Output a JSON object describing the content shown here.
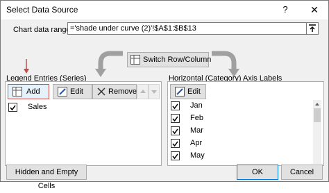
{
  "window": {
    "title": "Select Data Source",
    "help_glyph": "?",
    "close_glyph": "✕"
  },
  "range": {
    "label": "Chart data range:",
    "value": "='shade under curve (2)'!$A$1:$B$13"
  },
  "switch_button": {
    "label": "Switch Row/Column"
  },
  "legend": {
    "title": "Legend Entries (Series)",
    "toolbar": {
      "add": "Add",
      "edit": "Edit",
      "remove": "Remove"
    },
    "items": [
      {
        "label": "Sales",
        "checked": true
      }
    ]
  },
  "axis": {
    "title": "Horizontal (Category) Axis Labels",
    "toolbar": {
      "edit": "Edit"
    },
    "items": [
      {
        "label": "Jan",
        "checked": true
      },
      {
        "label": "Feb",
        "checked": true
      },
      {
        "label": "Mar",
        "checked": true
      },
      {
        "label": "Apr",
        "checked": true
      },
      {
        "label": "May",
        "checked": true
      }
    ]
  },
  "footer": {
    "hidden_empty": "Hidden and Empty Cells",
    "ok": "OK",
    "cancel": "Cancel"
  },
  "colors": {
    "annotation_arrow": "#c0504d",
    "default_button_border": "#0078d7"
  }
}
